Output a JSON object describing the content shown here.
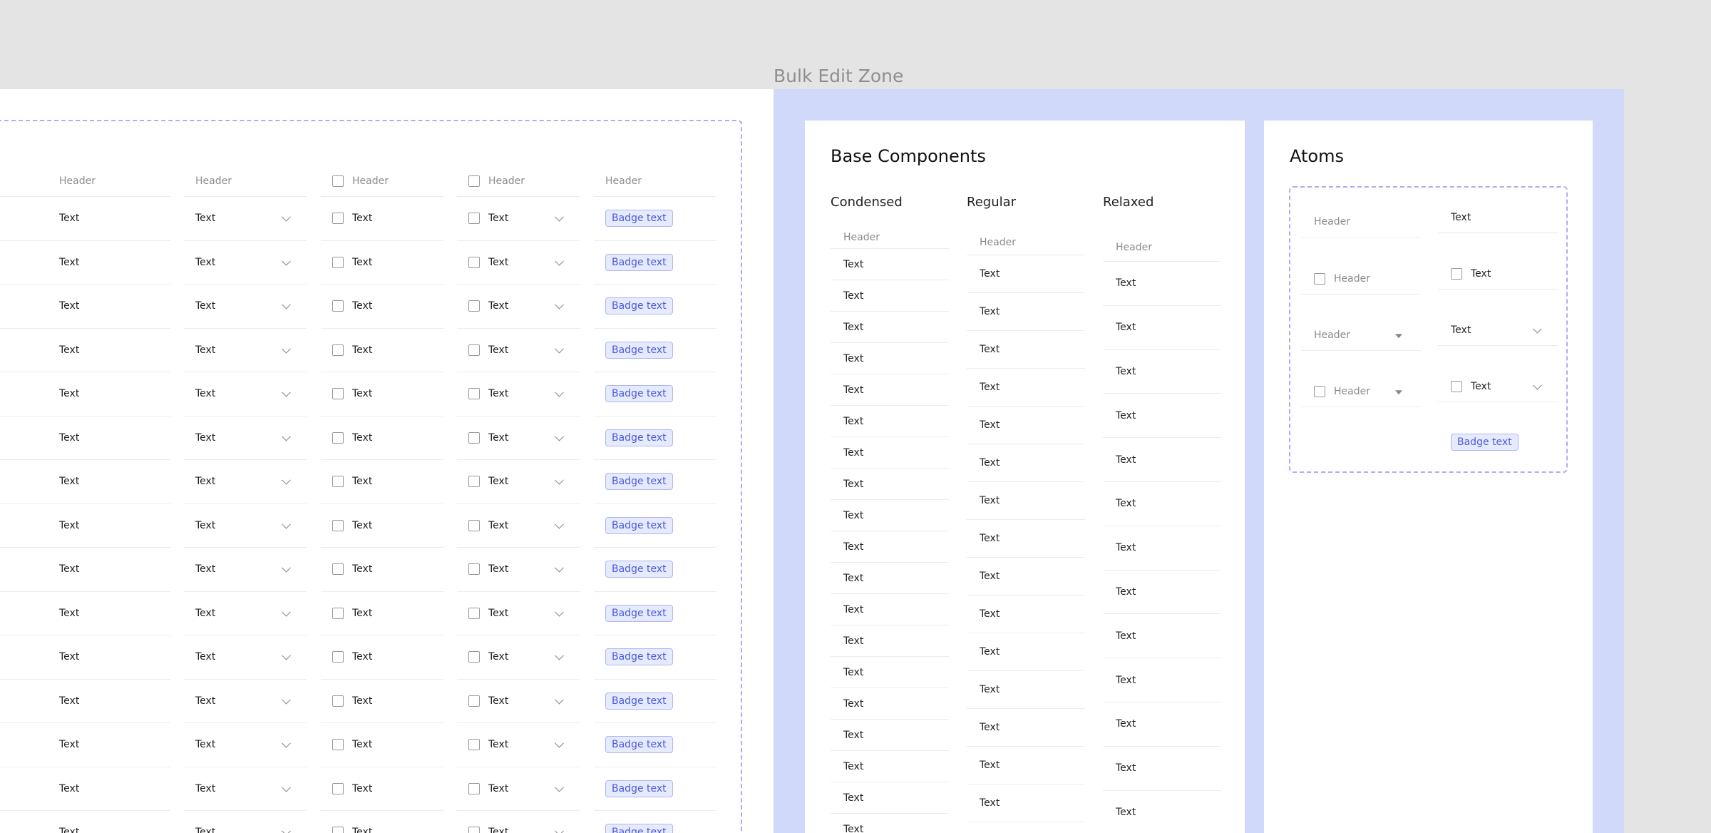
{
  "zone_label": "Bulk Edit Zone",
  "table": {
    "header_label": "Header",
    "cell_text": "Text",
    "badge_text": "Badge text",
    "row_count": 15
  },
  "base_components": {
    "title": "Base Components",
    "variants": [
      {
        "label": "Condensed",
        "header": "Header",
        "rows": 19
      },
      {
        "label": "Regular",
        "header": "Header",
        "rows": 15
      },
      {
        "label": "Relaxed",
        "header": "Header",
        "rows": 13
      }
    ],
    "cell_text": "Text"
  },
  "atoms": {
    "title": "Atoms",
    "header_label": "Header",
    "text_label": "Text",
    "badge_text": "Badge text"
  },
  "colors": {
    "canvas": "#e4e4e4",
    "zone_background": "#d0d9f9",
    "dashed_border": "#b3aaf2",
    "badge_text": "#4a5bdc",
    "badge_fill": "#e6eafd"
  }
}
